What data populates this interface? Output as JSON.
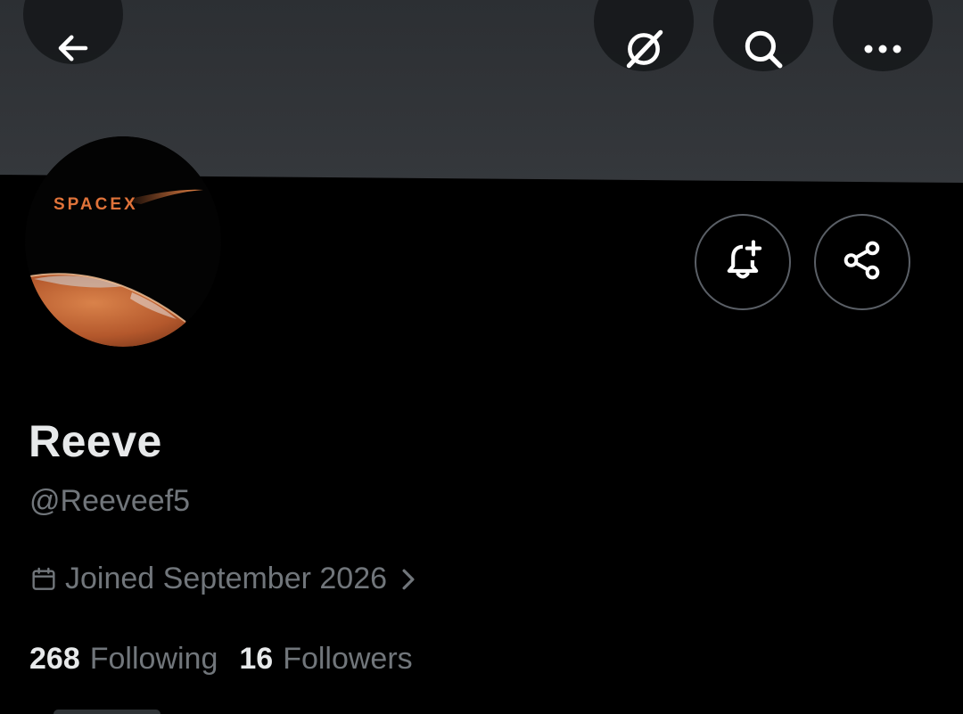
{
  "header": {
    "back_icon": "arrow-left-icon",
    "grok_icon": "grok-slash-circle-icon",
    "search_icon": "search-icon",
    "more_icon": "more-dots-icon",
    "banner_color": "#2c2f33"
  },
  "avatar": {
    "logo_text": "SPACEX",
    "logo_color": "#e0733a"
  },
  "actions": {
    "notify_icon": "bell-plus-icon",
    "share_icon": "share-icon"
  },
  "profile": {
    "display_name": "Reeve",
    "handle": "@Reeveef5",
    "joined": "Joined September 2026",
    "calendar_icon": "calendar-icon",
    "chevron_icon": "chevron-right-icon"
  },
  "stats": {
    "following_count": "268",
    "following_label": "Following",
    "followers_count": "16",
    "followers_label": "Followers"
  },
  "colors": {
    "text_primary": "#e7e9ea",
    "text_secondary": "#71767b",
    "background": "#000000"
  }
}
